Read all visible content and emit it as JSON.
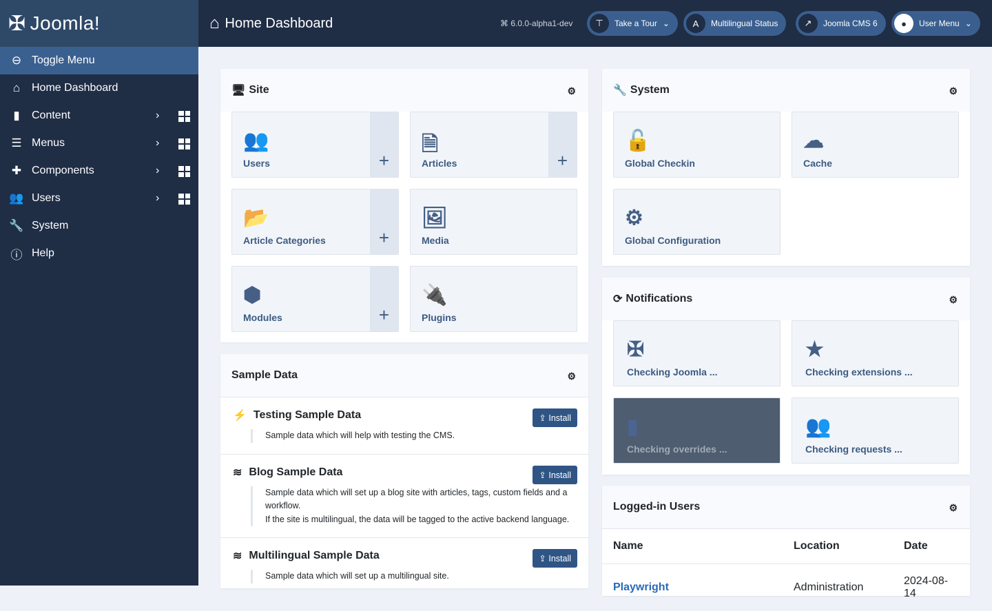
{
  "brand": {
    "name": "Joomla!"
  },
  "sidebar": {
    "items": [
      {
        "label": "Toggle Menu",
        "icon": "toggle-icon"
      },
      {
        "label": "Home Dashboard",
        "icon": "home-icon"
      },
      {
        "label": "Content",
        "icon": "file-icon",
        "sub": true
      },
      {
        "label": "Menus",
        "icon": "list-icon",
        "sub": true
      },
      {
        "label": "Components",
        "icon": "puzzle-icon",
        "sub": true
      },
      {
        "label": "Users",
        "icon": "users-icon",
        "sub": true
      },
      {
        "label": "System",
        "icon": "wrench-icon"
      },
      {
        "label": "Help",
        "icon": "info-icon"
      }
    ]
  },
  "header": {
    "title": "Home Dashboard",
    "version": "6.0.0-alpha1-dev",
    "buttons": [
      "Take a Tour",
      "Multilingual Status",
      "Joomla CMS 6",
      "User Menu"
    ]
  },
  "site": {
    "title": "Site",
    "tiles": [
      "Users",
      "Articles",
      "Article Categories",
      "Media",
      "Modules",
      "Plugins"
    ]
  },
  "system": {
    "title": "System",
    "tiles": [
      "Global Checkin",
      "Cache",
      "Global Configuration"
    ]
  },
  "notifications": {
    "title": "Notifications",
    "tiles": [
      "Checking Joomla ...",
      "Checking extensions ...",
      "Checking overrides ...",
      "Checking requests ..."
    ]
  },
  "sample": {
    "title": "Sample Data",
    "install": "Install",
    "items": [
      {
        "title": "Testing Sample Data",
        "desc": "Sample data which will help with testing the CMS."
      },
      {
        "title": "Blog Sample Data",
        "desc": "Sample data which will set up a blog site with articles, tags, custom fields and a workflow.",
        "desc2": "If the site is multilingual, the data will be tagged to the active backend language."
      },
      {
        "title": "Multilingual Sample Data",
        "desc": "Sample data which will set up a multilingual site."
      }
    ]
  },
  "logged": {
    "title": "Logged-in Users",
    "columns": [
      "Name",
      "Location",
      "Date"
    ],
    "rows": [
      [
        "Playwright",
        "Administration",
        "2024-08-14"
      ]
    ]
  },
  "colors": {
    "sidebar": "#1f2d45",
    "accent": "#3a6090",
    "tile_text": "#3d5a80"
  }
}
